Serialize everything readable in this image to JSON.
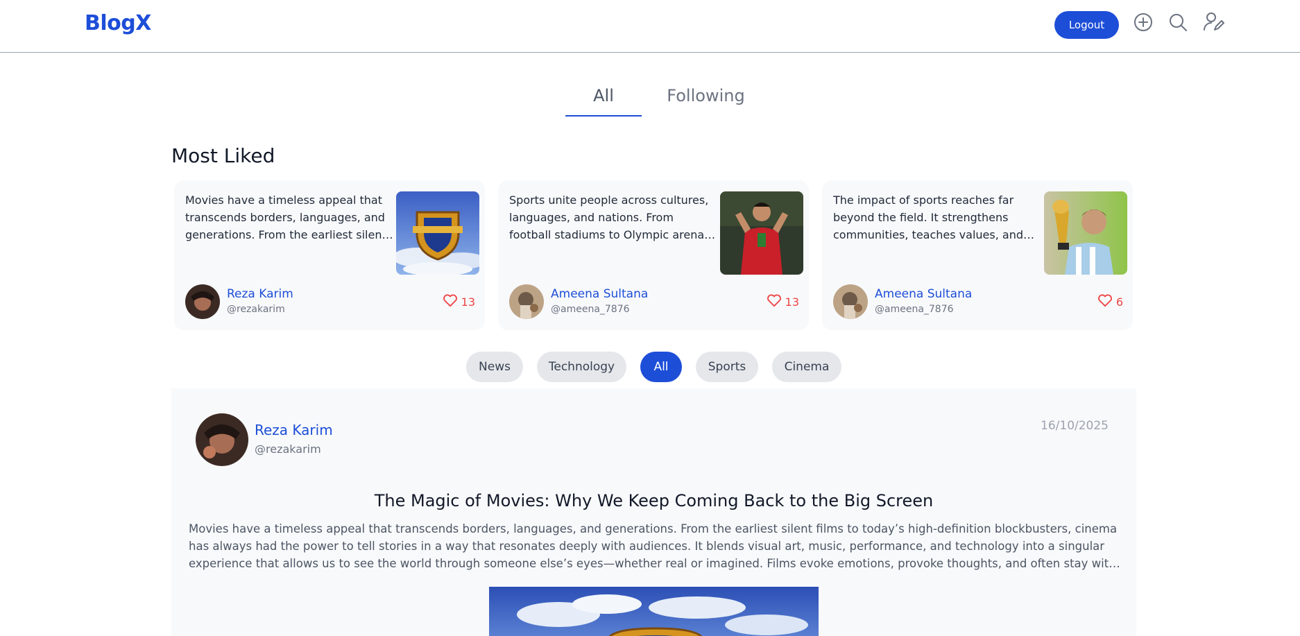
{
  "header": {
    "logo": "BlogX",
    "logout_label": "Logout",
    "icons": [
      "plus-circle-icon",
      "search-icon",
      "user-edit-icon"
    ]
  },
  "tabs": [
    {
      "label": "All",
      "active": true
    },
    {
      "label": "Following",
      "active": false
    }
  ],
  "most_liked": {
    "title": "Most Liked",
    "cards": [
      {
        "text": "Movies have a timeless appeal that transcends borders, languages, and generations. From the earliest silent films to today's high-definition blockbusters",
        "author_name": "Reza Karim",
        "author_handle": "@rezakarim",
        "likes": "13",
        "thumbnail": "studio-shield-logo-image"
      },
      {
        "text": "Sports unite people across cultures, languages, and nations. From football stadiums to Olympic arenas, the spirit of competition",
        "author_name": "Ameena Sultana",
        "author_handle": "@ameena_7876",
        "likes": "13",
        "thumbnail": "football-player-celebrating-image"
      },
      {
        "text": "The impact of sports reaches far beyond the field. It strengthens communities, teaches values, and brings people together",
        "author_name": "Ameena Sultana",
        "author_handle": "@ameena_7876",
        "likes": "6",
        "thumbnail": "player-with-trophy-image"
      }
    ]
  },
  "categories": [
    {
      "label": "News",
      "active": false
    },
    {
      "label": "Technology",
      "active": false
    },
    {
      "label": "All",
      "active": true
    },
    {
      "label": "Sports",
      "active": false
    },
    {
      "label": "Cinema",
      "active": false
    }
  ],
  "post": {
    "author_name": "Reza Karim",
    "author_handle": "@rezakarim",
    "date": "16/10/2025",
    "title": "The Magic of Movies: Why We Keep Coming Back to the Big Screen",
    "body": "Movies have a timeless appeal that transcends borders, languages, and generations. From the earliest silent films to today’s high-definition blockbusters, cinema has always had the power to tell stories in a way that resonates deeply with audiences. It blends visual art, music, performance, and technology into a singular experience that allows us to see the world through someone else’s eyes—whether real or imagined. Films evoke emotions, provoke thoughts, and often stay with us long after the credits roll. Even in the age of streaming",
    "image": "studio-shield-logo-image"
  },
  "colors": {
    "accent": "#1d4ed8",
    "like": "#ef4444",
    "card_bg": "#f8f9fb"
  }
}
